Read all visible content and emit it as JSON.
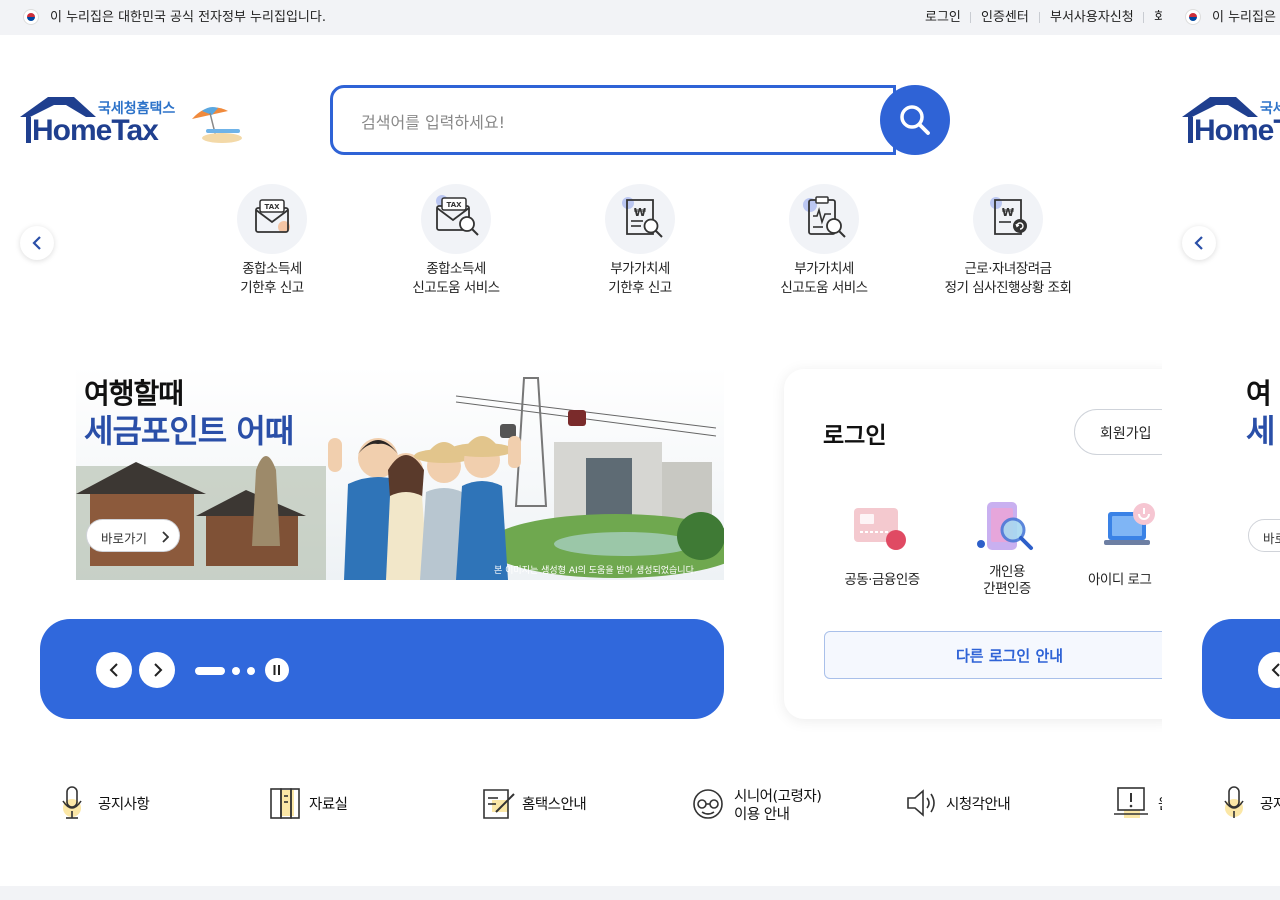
{
  "gov_bar": {
    "notice": "이 누리집은 대한민국 공식 전자정부 누리집입니다.",
    "links": [
      "로그인",
      "인증센터",
      "부서사용자신청",
      "회"
    ]
  },
  "logo": {
    "small": "국세청홈택스",
    "big": "HomeTax"
  },
  "search": {
    "placeholder": "검색어를 입력하세요!"
  },
  "quick_services": [
    {
      "line1": "종합소득세",
      "line2": "기한후 신고",
      "icon": "tax-envelope-icon"
    },
    {
      "line1": "종합소득세",
      "line2": "신고도움 서비스",
      "icon": "tax-envelope-search-icon"
    },
    {
      "line1": "부가가치세",
      "line2": "기한후 신고",
      "icon": "receipt-search-icon"
    },
    {
      "line1": "부가가치세",
      "line2": "신고도움 서비스",
      "icon": "clipboard-search-icon"
    },
    {
      "line1": "근로·자녀장려금",
      "line2": "정기 심사진행상황 조회",
      "icon": "document-refresh-icon"
    }
  ],
  "banner": {
    "title1": "여행할때",
    "title2": "세금포인트 어때",
    "go": "바로가기",
    "ai_note": "본 이미지는 생성형 AI의 도움을 받아 생성되었습니다."
  },
  "login": {
    "title": "로그인",
    "join": "회원가입",
    "methods": [
      {
        "label": "공동·금융인증",
        "icon": "certificate-card-icon"
      },
      {
        "label1": "개인용",
        "label2": "간편인증",
        "icon": "phone-search-icon"
      },
      {
        "label": "아이디 로그",
        "icon": "laptop-power-icon"
      }
    ],
    "other": "다른 로그인 안내"
  },
  "bottom_links": [
    {
      "label": "공지사항",
      "icon": "microphone-icon"
    },
    {
      "label": "자료실",
      "icon": "folder-icon"
    },
    {
      "label": "홈택스안내",
      "icon": "edit-note-icon"
    },
    {
      "label1": "시니어(고령자)",
      "label2": "이용 안내",
      "icon": "senior-icon"
    },
    {
      "label": "시청각안내",
      "icon": "speaker-icon"
    },
    {
      "label": "원",
      "icon": "laptop-alert-icon"
    }
  ],
  "repeat_right": {
    "notice": "이 누리집은",
    "banner_t1": "여",
    "banner_t2": "세",
    "go": "바로",
    "bottom": "공지"
  },
  "colors": {
    "primary": "#3068dc",
    "navy": "#1f3f8f",
    "accent": "#2d73c9"
  }
}
